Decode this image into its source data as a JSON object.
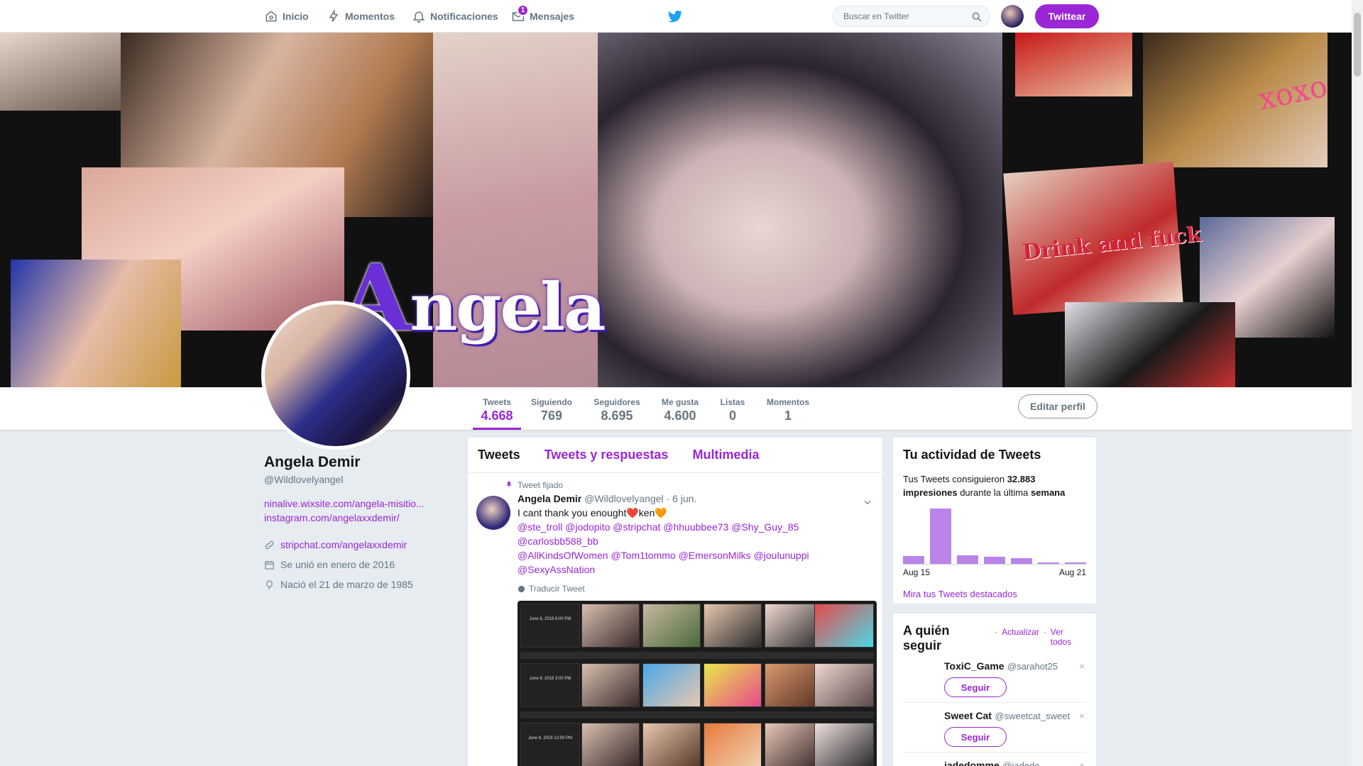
{
  "nav": {
    "home": "Inicio",
    "moments": "Momentos",
    "notifications": "Notificaciones",
    "messages": "Mensajes",
    "messages_badge": "1",
    "search_placeholder": "Buscar en Twitter",
    "tweet_button": "Twittear"
  },
  "banner": {
    "brand_initial": "A",
    "brand_rest": "ngela",
    "xoxo": "xoxo",
    "drink": "Drink and fuck"
  },
  "stats": [
    {
      "label": "Tweets",
      "value": "4.668"
    },
    {
      "label": "Siguiendo",
      "value": "769"
    },
    {
      "label": "Seguidores",
      "value": "8.695"
    },
    {
      "label": "Me gusta",
      "value": "4.600"
    },
    {
      "label": "Listas",
      "value": "0"
    },
    {
      "label": "Momentos",
      "value": "1"
    }
  ],
  "edit_profile": "Editar perfil",
  "profile": {
    "name": "Angela Demir",
    "handle": "@Wildlovelyangel",
    "bio_link_1": "ninalive.wixsite.com/angela-misitio...",
    "bio_link_2": "instagram.com/angelaxxdemir/",
    "website": "stripchat.com/angelaxxdemir",
    "joined": "Se unió en enero de 2016",
    "born": "Nació el 21 de marzo de 1985"
  },
  "timeline": {
    "tabs": [
      "Tweets",
      "Tweets y respuestas",
      "Multimedia"
    ],
    "tweet": {
      "pinned": "Tweet fijado",
      "name": "Angela Demir",
      "handle": "@Wildlovelyangel",
      "date": "· 6 jun.",
      "text_1": "I cant thank you enought",
      "heart": "❤️",
      "text_2": "ken",
      "heart2": "🧡",
      "mentions_1": "@ste_troll @jodopito @stripchat @hhuubbee73 @Shy_Guy_85 @carlosbb588_bb",
      "mentions_2": "@AllKindsOfWomen @Tom1tommo @EmersonMilks @joulunuppi",
      "mentions_3": "@SexyAssNation",
      "translate": "Traducir Tweet",
      "media_rows": [
        {
          "date": "June 6, 2018 6:00 PM"
        },
        {
          "date": "June 6, 2018 3:00 PM"
        },
        {
          "date": "June 6, 2018 12:00 PM"
        }
      ]
    }
  },
  "activity": {
    "title": "Tu actividad de Tweets",
    "summary_pre": "Tus Tweets consiguieron ",
    "impressions": "32.883",
    "summary_mid": "impresiones",
    "summary_post": " durante la última ",
    "summary_end": "semana",
    "bars": [
      0.14,
      1.0,
      0.16,
      0.13,
      0.1,
      0.02,
      0.02
    ],
    "axis_start": "Aug 15",
    "axis_end": "Aug 21",
    "link": "Mira tus Tweets destacados"
  },
  "who_to_follow": {
    "title": "A quién seguir",
    "refresh": "Actualizar",
    "separator": "·",
    "view_all": "Ver todos",
    "follow_label": "Seguir",
    "dismiss": "×",
    "suggestions": [
      {
        "name": "ToxiC_Game",
        "handle": "@sarahot25"
      },
      {
        "name": "Sweet Cat",
        "handle": "@sweetcat_sweet"
      },
      {
        "name": "jadedomme",
        "handle": "@jadedo..."
      }
    ]
  },
  "colors": {
    "accent": "#9b26d6",
    "background": "#e6ecf0"
  }
}
